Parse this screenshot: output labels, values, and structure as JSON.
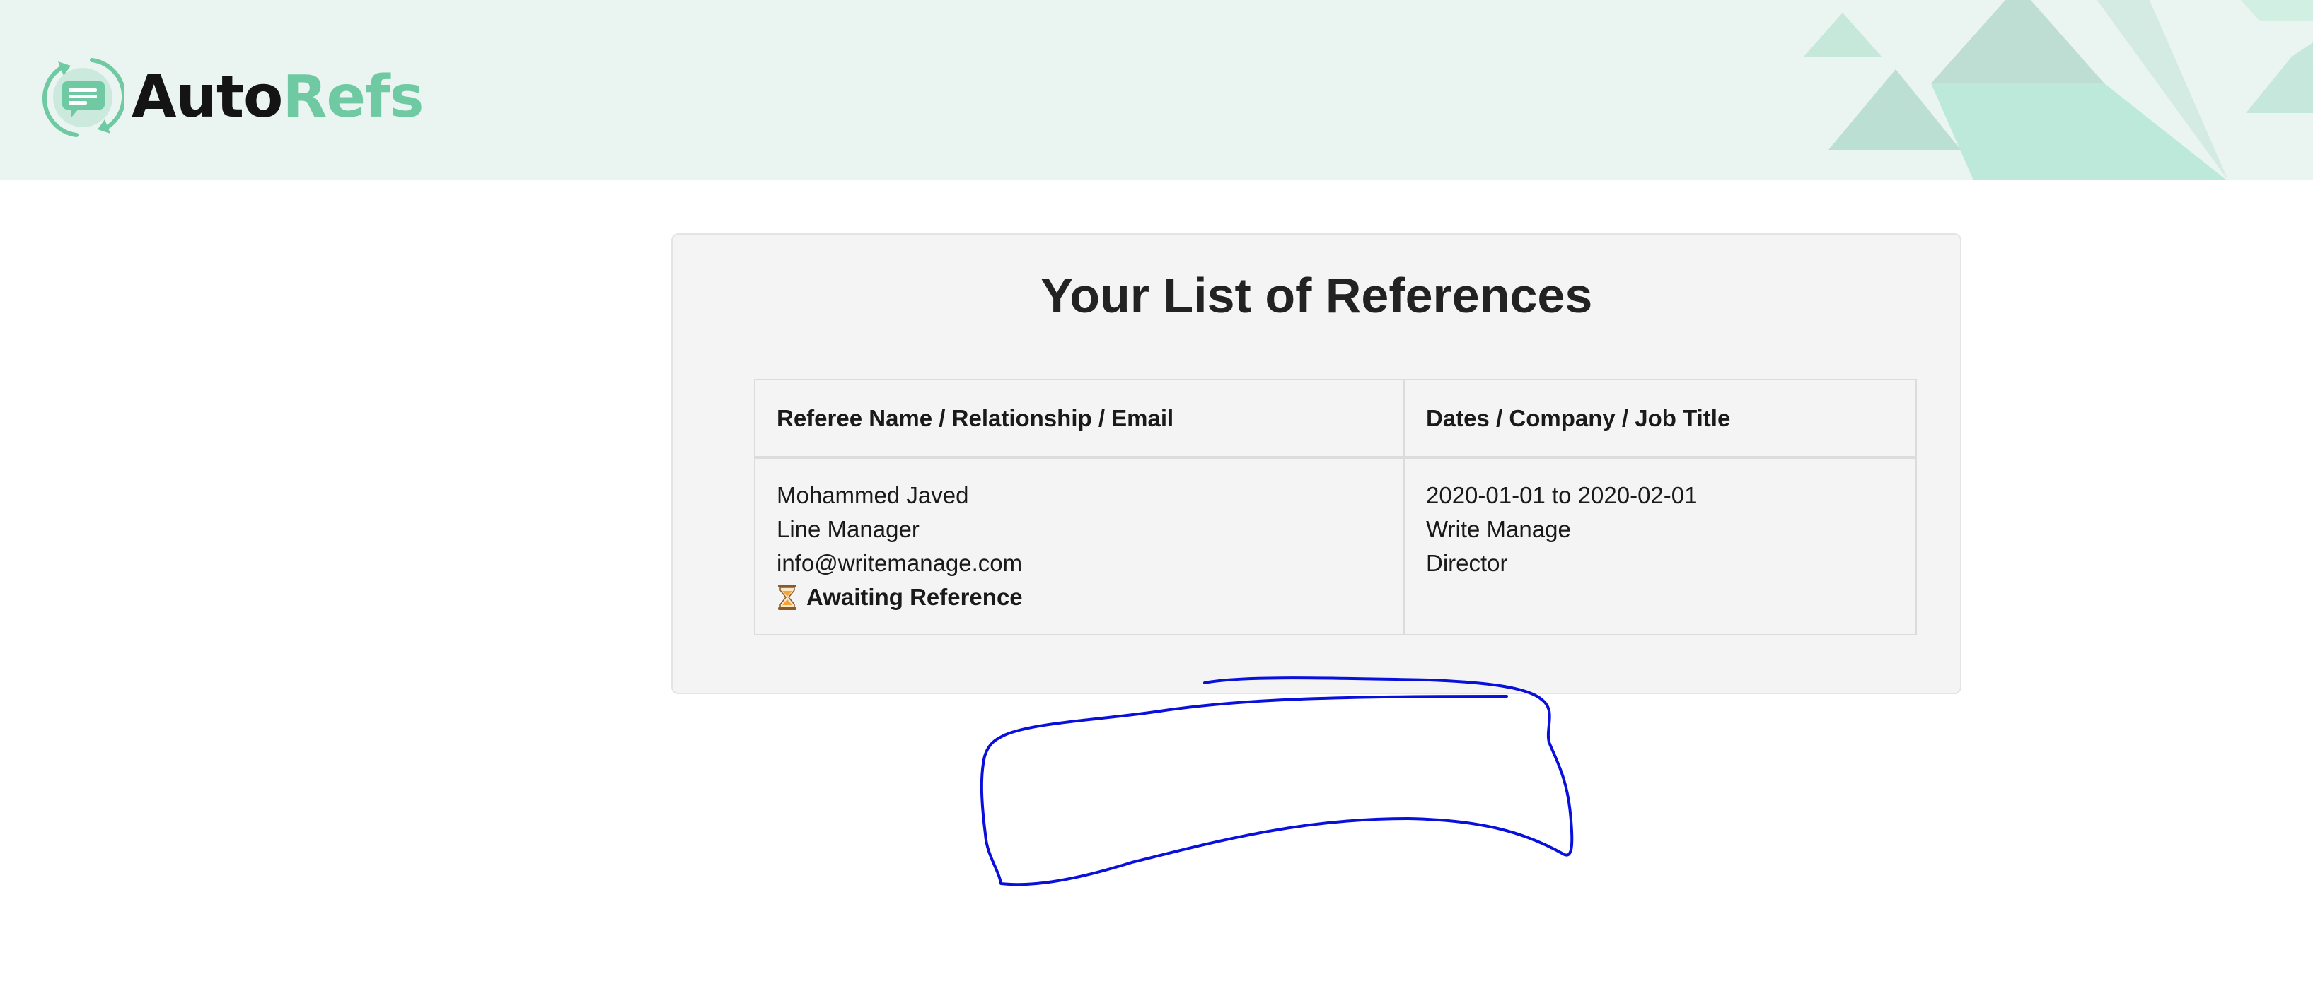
{
  "header": {
    "logo": {
      "part_a": "Auto",
      "part_b": "Refs",
      "icon": "chat-refresh-logo-icon",
      "colors": {
        "dark": "#141414",
        "accent": "#6fcaa4"
      }
    },
    "background_color": "#eaf4f0"
  },
  "main": {
    "title": "Your List of References",
    "table": {
      "columns": [
        "Referee Name / Relationship / Email",
        "Dates / Company / Job Title"
      ],
      "rows": [
        {
          "referee": {
            "name": "Mohammed Javed",
            "relationship": "Line Manager",
            "email": "info@writemanage.com",
            "status_icon": "hourglass-icon",
            "status": "Awaiting Reference"
          },
          "job": {
            "dates": "2020-01-01 to 2020-02-01",
            "company": "Write Manage",
            "title": "Director"
          }
        }
      ]
    }
  },
  "annotation": {
    "type": "freehand-outline",
    "color": "#0a10dc"
  }
}
